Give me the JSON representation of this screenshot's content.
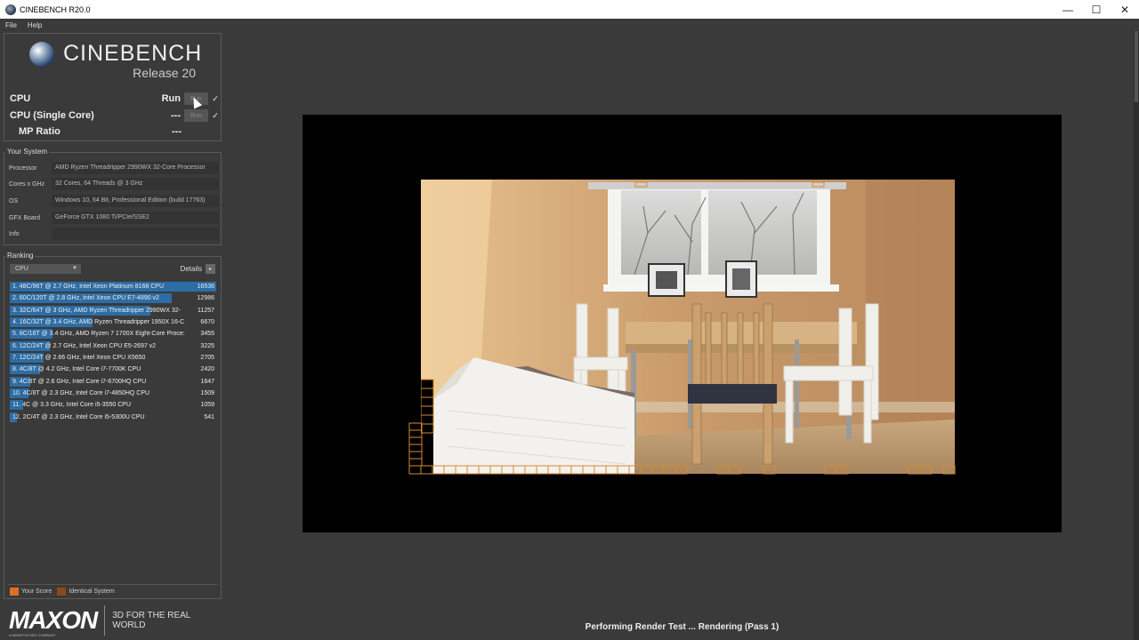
{
  "window": {
    "title": "CINEBENCH R20.0",
    "minimize": "—",
    "maximize": "☐",
    "close": "✕"
  },
  "menu": [
    "File",
    "Help"
  ],
  "logo": {
    "name": "CINEBENCH",
    "release": "Release 20"
  },
  "tests": [
    {
      "label": "CPU",
      "value": "Run",
      "button": "Run",
      "check": "✓"
    },
    {
      "label": "CPU (Single Core)",
      "value": "---",
      "button": "Run",
      "check": "✓"
    },
    {
      "label": "MP Ratio",
      "value": "---"
    }
  ],
  "your_system": {
    "heading": "Your System",
    "rows": [
      {
        "key": "Processor",
        "value": "AMD Ryzen Threadripper 2990WX 32-Core Processor"
      },
      {
        "key": "Cores x GHz",
        "value": "32 Cores, 64 Threads @ 3 GHz"
      },
      {
        "key": "OS",
        "value": "Windows 10, 64 Bit, Professional Edition (build 17763)"
      },
      {
        "key": "GFX Board",
        "value": "GeForce GTX 1080 Ti/PCIe/SSE2"
      },
      {
        "key": "Info",
        "value": ""
      }
    ]
  },
  "ranking": {
    "heading": "Ranking",
    "selected": "CPU",
    "details_label": "Details",
    "details_button": "▸",
    "entries": [
      {
        "name": "1. 48C/96T @ 2.7 GHz, Intel Xeon Platinum 8168 CPU",
        "score": "16536",
        "bar_fraction": 1.0
      },
      {
        "name": "2. 60C/120T @ 2.8 GHz, Intel Xeon CPU E7-4890 v2",
        "score": "12986",
        "bar_fraction": 0.785
      },
      {
        "name": "3. 32C/64T @ 3 GHz, AMD Ryzen Threadripper 2990WX 32-",
        "score": "11257",
        "bar_fraction": 0.68
      },
      {
        "name": "4. 16C/32T @ 3.4 GHz, AMD Ryzen Threadripper 1950X 16-C",
        "score": "6670",
        "bar_fraction": 0.403
      },
      {
        "name": "5. 8C/16T @ 3.4 GHz, AMD Ryzen 7 1700X Eight-Core Proce:",
        "score": "3455",
        "bar_fraction": 0.209
      },
      {
        "name": "6. 12C/24T @ 2.7 GHz, Intel Xeon CPU E5-2697 v2",
        "score": "3225",
        "bar_fraction": 0.195
      },
      {
        "name": "7. 12C/24T @ 2.66 GHz, Intel Xeon CPU X5650",
        "score": "2705",
        "bar_fraction": 0.164
      },
      {
        "name": "8. 4C/8T @ 4.2 GHz, Intel Core i7-7700K CPU",
        "score": "2420",
        "bar_fraction": 0.146
      },
      {
        "name": "9. 4C/8T @ 2.6 GHz, Intel Core i7-6700HQ CPU",
        "score": "1647",
        "bar_fraction": 0.1
      },
      {
        "name": "10. 4C/8T @ 2.3 GHz, Intel Core i7-4850HQ CPU",
        "score": "1509",
        "bar_fraction": 0.091
      },
      {
        "name": "11. 4C @ 3.3 GHz, Intel Core i5-3550 CPU",
        "score": "1059",
        "bar_fraction": 0.064
      },
      {
        "name": "12. 2C/4T @ 2.3 GHz, Intel Core i5-5300U CPU",
        "score": "541",
        "bar_fraction": 0.033
      }
    ]
  },
  "legend": {
    "your_score": "Your Score",
    "your_score_color": "#e07020",
    "identical": "Identical System",
    "identical_color": "#8a4a1a"
  },
  "maxon": {
    "name": "MAXON",
    "sub": "A NEMETSCHEK COMPANY",
    "tagline": "3D FOR THE REAL WORLD"
  },
  "status": "Performing Render Test ... Rendering (Pass 1)",
  "colors": {
    "bar": "#2d6da5",
    "bucket": "#d88a30"
  }
}
